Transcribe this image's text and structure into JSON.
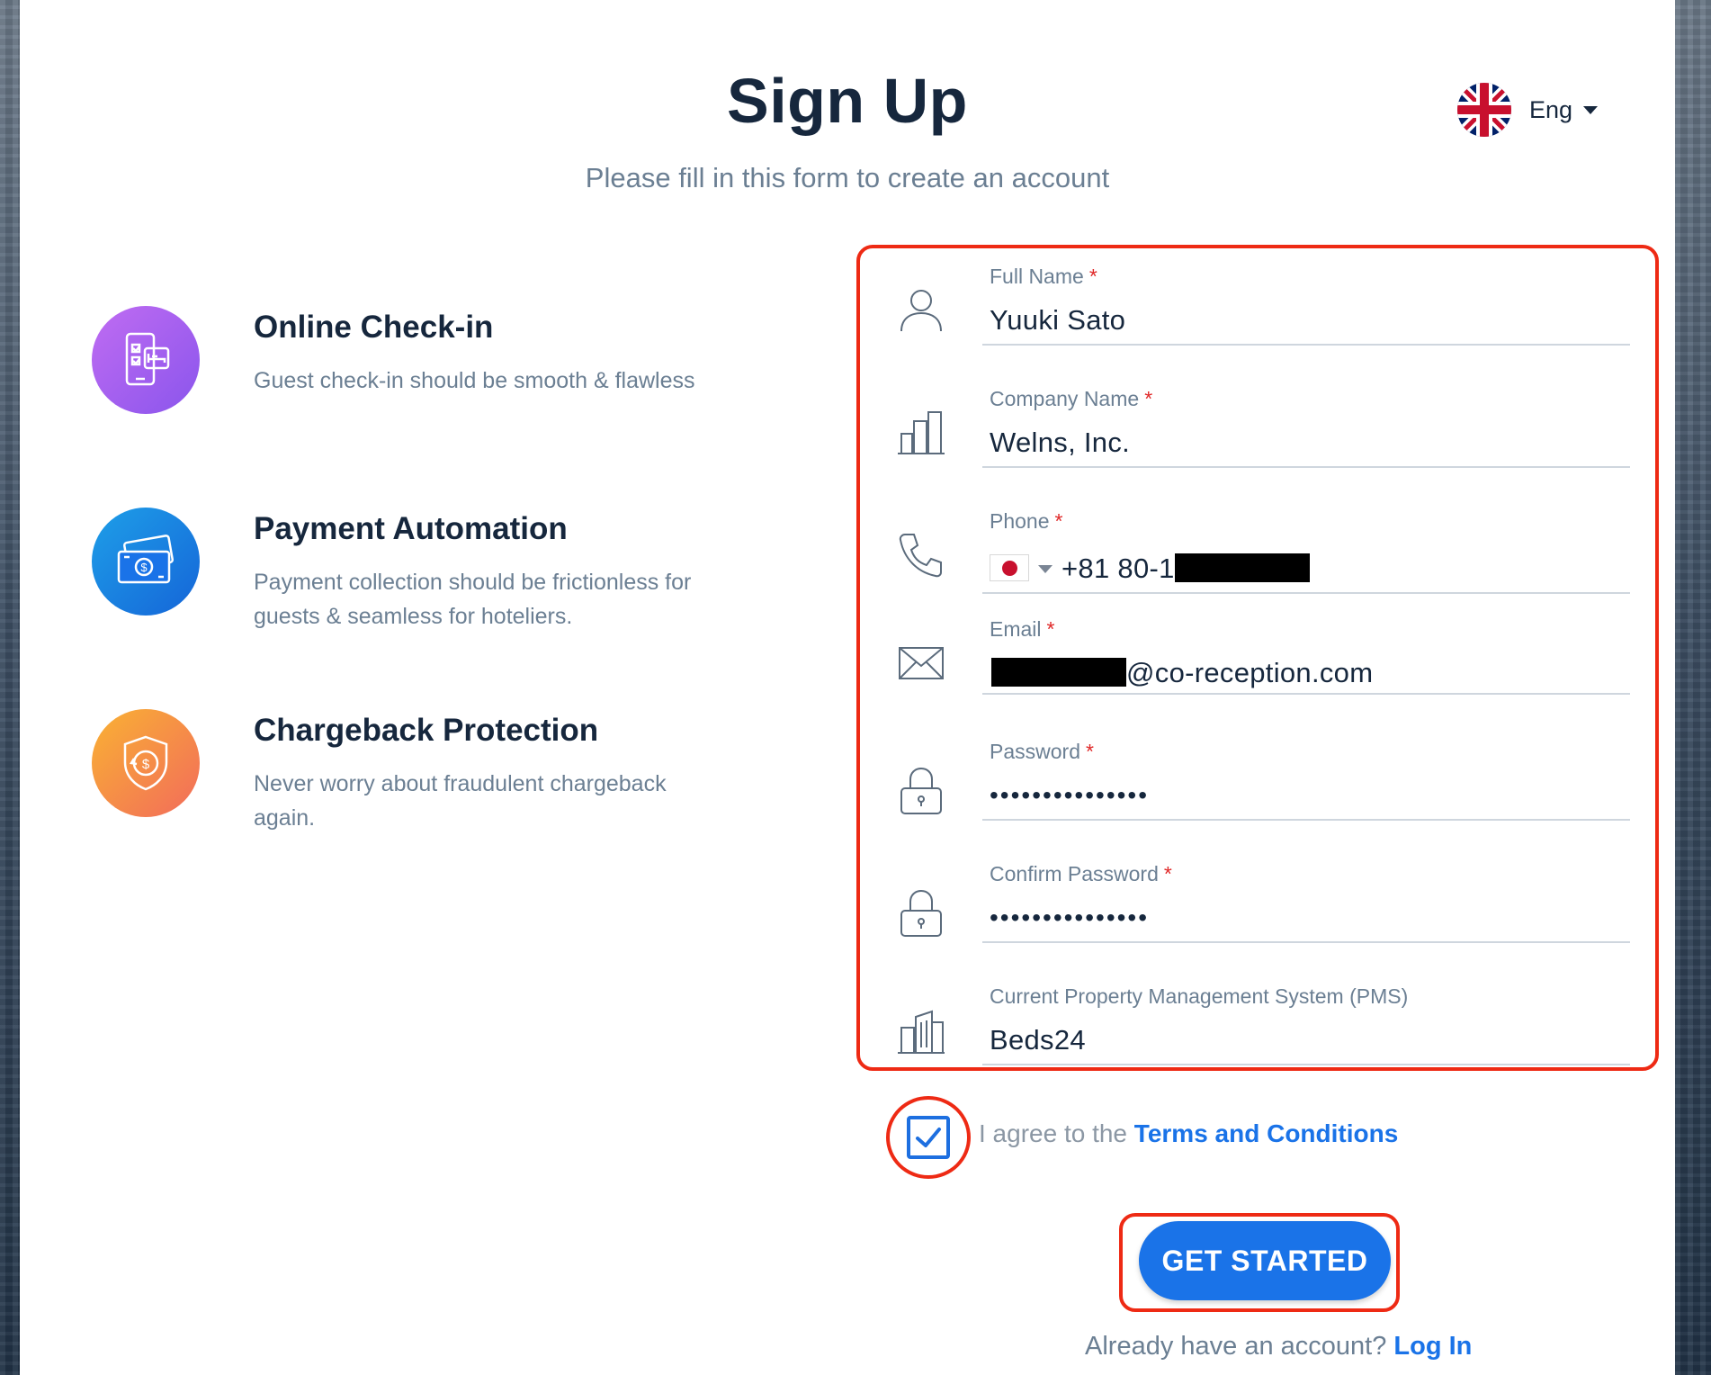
{
  "header": {
    "title": "Sign Up",
    "subtitle": "Please fill in this form to create an account",
    "language": {
      "label": "Eng",
      "flag": "uk-flag-icon"
    }
  },
  "features": [
    {
      "icon": "mobile-checkin-icon",
      "title": "Online Check-in",
      "description": "Guest check-in should be smooth & flawless",
      "color": "#9b59f0"
    },
    {
      "icon": "payment-cash-icon",
      "title": "Payment Automation",
      "description": "Payment collection should be frictionless for guests & seamless for hoteliers.",
      "color": "#1a73e8"
    },
    {
      "icon": "shield-refund-icon",
      "title": "Chargeback Protection",
      "description": "Never worry about fraudulent chargeback again.",
      "color": "#f5803e"
    }
  ],
  "form": {
    "required_mark": "*",
    "full_name": {
      "label": "Full Name",
      "value": "Yuuki Sato",
      "icon": "user-icon"
    },
    "company": {
      "label": "Company Name",
      "value": "Welns, Inc.",
      "icon": "building-icon"
    },
    "phone": {
      "label": "Phone",
      "value": "+81 80-1",
      "country_flag": "japan-flag-icon",
      "icon": "phone-icon"
    },
    "email": {
      "label": "Email",
      "value": "@co-reception.com",
      "icon": "envelope-icon"
    },
    "password": {
      "label": "Password",
      "value": "•••••••••••••••",
      "icon": "lock-icon"
    },
    "confirm_password": {
      "label": "Confirm Password",
      "value": "•••••••••••••••",
      "icon": "lock-icon"
    },
    "pms": {
      "label": "Current Property Management System (PMS)",
      "value": "Beds24",
      "icon": "buildings-icon"
    }
  },
  "agreement": {
    "checked": true,
    "text": "I agree to the ",
    "link": "Terms and Conditions"
  },
  "cta": {
    "label": "GET STARTED"
  },
  "login": {
    "text": "Already have an account? ",
    "link": "Log In"
  },
  "colors": {
    "primary": "#1a73e8",
    "heading": "#16273d",
    "muted": "#6b7f93",
    "annotation": "#ee2a14",
    "required": "#e02828"
  }
}
